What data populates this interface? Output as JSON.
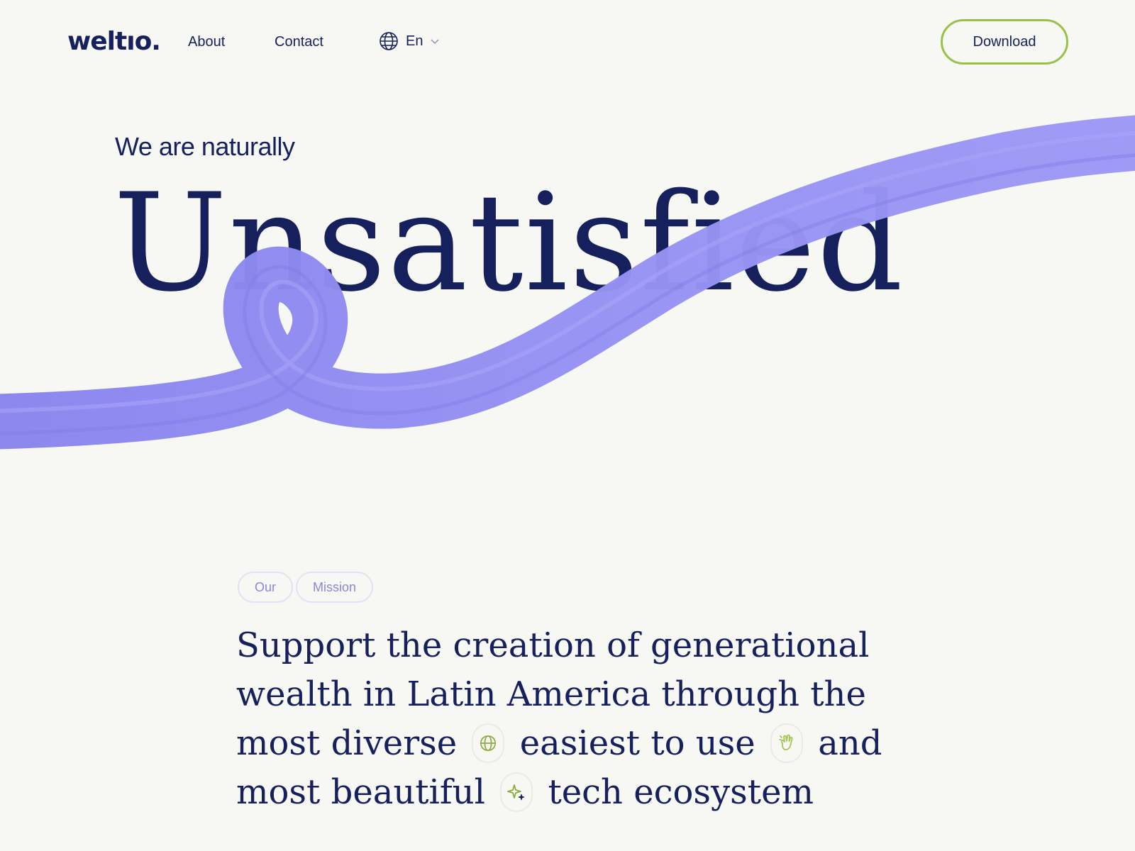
{
  "nav": {
    "logo": "weltıo.",
    "links": [
      {
        "label": "About"
      },
      {
        "label": "Contact"
      }
    ],
    "language": "En",
    "download_label": "Download"
  },
  "hero": {
    "eyebrow": "We are naturally",
    "word": "Unsatisfied"
  },
  "mission": {
    "tags": [
      "Our",
      "Mission"
    ],
    "segments": [
      "Support the creation of generational",
      "wealth in Latin America through the",
      "most diverse",
      "easiest to use",
      "and",
      "most beautiful",
      "tech ecosystem"
    ],
    "icons": [
      "globe-icon",
      "hand-icon",
      "sparkle-icon"
    ]
  },
  "colors": {
    "background": "#f7f7f3",
    "text": "#15205c",
    "accent_green": "#9bc048",
    "ribbon": "#8f8cf0",
    "tag_text": "#8a87dc"
  }
}
